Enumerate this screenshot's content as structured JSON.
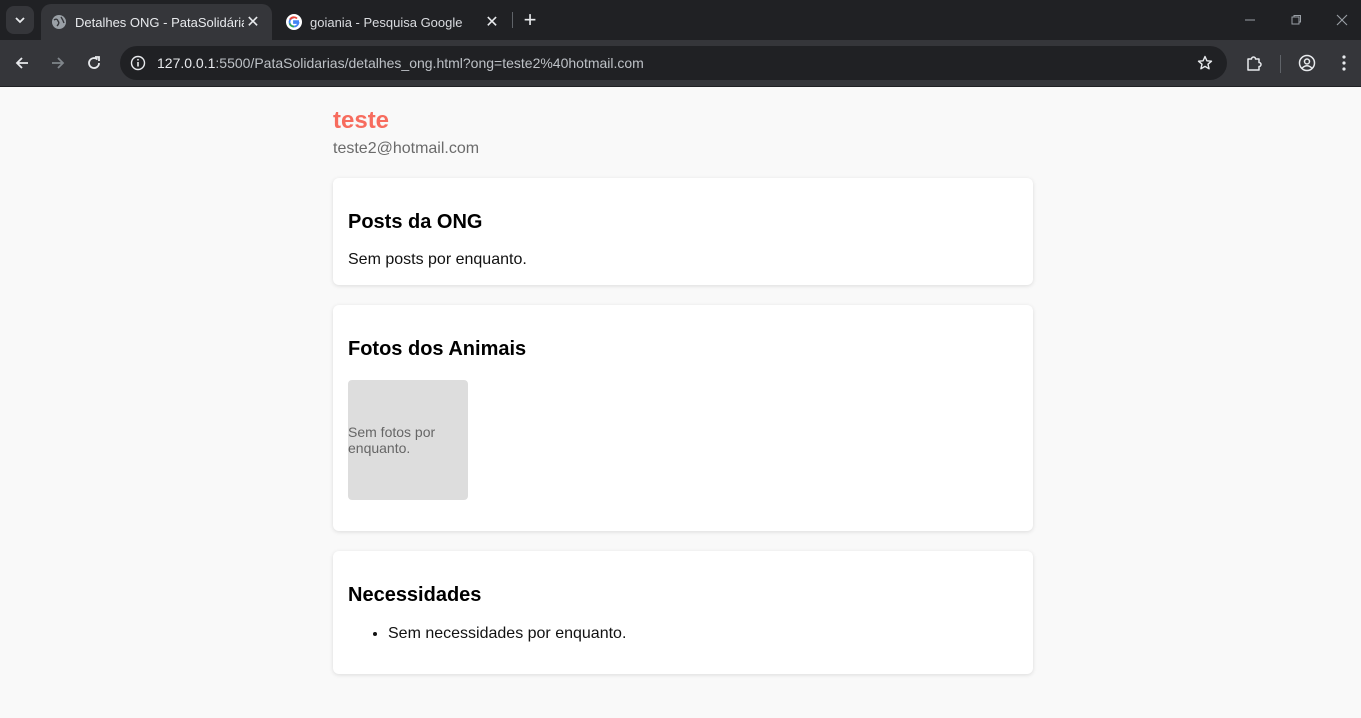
{
  "browser": {
    "tabs": [
      {
        "title": "Detalhes ONG - PataSolidárias",
        "active": true,
        "favicon": "globe-icon"
      },
      {
        "title": "goiania - Pesquisa Google",
        "active": false,
        "favicon": "google-icon"
      }
    ],
    "url": {
      "host": "127.0.0.1",
      "rest": ":5500/PataSolidarias/detalhes_ong.html?ong=teste2%40hotmail.com"
    }
  },
  "ong": {
    "name": "teste",
    "email": "teste2@hotmail.com"
  },
  "sections": {
    "posts": {
      "title": "Posts da ONG",
      "empty": "Sem posts por enquanto."
    },
    "fotos": {
      "title": "Fotos dos Animais",
      "empty": "Sem fotos por enquanto."
    },
    "necessidades": {
      "title": "Necessidades",
      "items": [
        "Sem necessidades por enquanto."
      ]
    }
  },
  "colors": {
    "accent": "#f76c5e",
    "page_bg": "#f9f9f9",
    "card_bg": "#ffffff",
    "placeholder_bg": "#dddddd"
  }
}
